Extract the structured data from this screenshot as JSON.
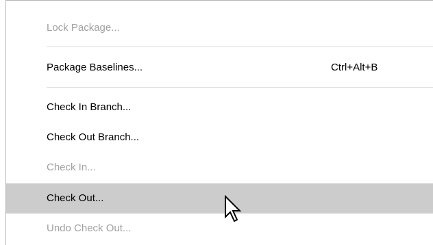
{
  "menu": {
    "lock_package": "Lock Package...",
    "package_baselines": "Package Baselines...",
    "package_baselines_shortcut": "Ctrl+Alt+B",
    "check_in_branch": "Check In Branch...",
    "check_out_branch": "Check Out Branch...",
    "check_in": "Check In...",
    "check_out": "Check Out...",
    "undo_check_out": "Undo Check Out..."
  },
  "colors": {
    "highlight": "#cccccc",
    "disabled_text": "#a0a0a0",
    "separator": "#d8d8d8"
  },
  "icons": {
    "cursor": "arrow-cursor-icon"
  }
}
